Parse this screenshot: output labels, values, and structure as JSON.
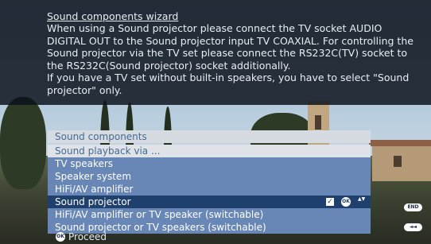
{
  "description": {
    "title": "Sound components wizard",
    "lines": [
      "When using a Sound projector please connect the TV socket AUDIO DIGITAL OUT to the Sound projector input TV COAXIAL. For controlling the Sound projector via the TV set please connect the RS232C(TV) socket to the RS232C(Sound projector) socket additionally.",
      "If you have a TV set without built-in speakers, you have to select \"Sound projector\" only."
    ]
  },
  "menu": {
    "heading": "Sound components",
    "subheading": "Sound playback via ...",
    "items": [
      {
        "label": "TV speakers",
        "selected": false
      },
      {
        "label": "Speaker system",
        "selected": false
      },
      {
        "label": "HiFi/AV amplifier",
        "selected": false
      },
      {
        "label": "Sound projector",
        "selected": true,
        "checked": true
      },
      {
        "label": "HiFi/AV amplifier or TV speaker (switchable)",
        "selected": false
      },
      {
        "label": "Sound projector or TV speakers (switchable)",
        "selected": false
      }
    ],
    "ok_icon": "OK",
    "check_glyph": "✓",
    "updown_glyph": "▲▼"
  },
  "footer": {
    "ok_icon": "OK",
    "proceed_label": "Proceed",
    "end_label": "END",
    "back_icon": "◄◄"
  },
  "colors": {
    "menu_list": "#6886b6",
    "menu_selected": "#1f3f6d",
    "menu_heading_text": "#456a92"
  }
}
